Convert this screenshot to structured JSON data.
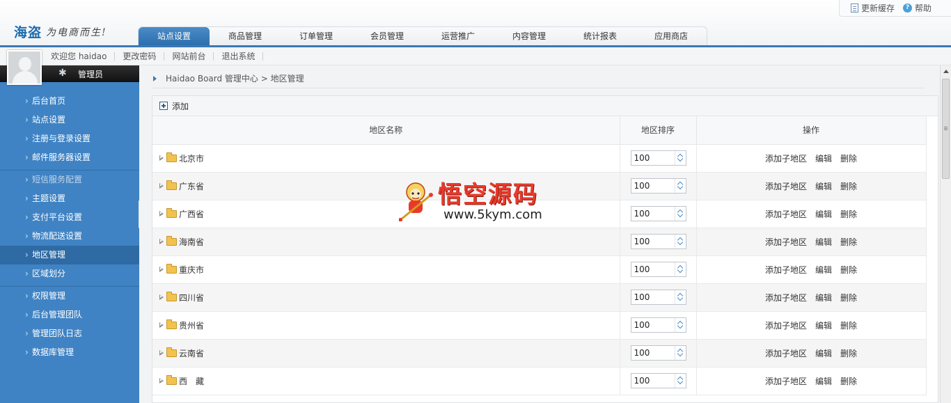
{
  "brand": {
    "logo": "海盗",
    "slogan": "为电商而生!"
  },
  "toplinks": {
    "refresh_cache": "更新缓存",
    "help": "帮助"
  },
  "tabs": [
    "站点设置",
    "商品管理",
    "订单管理",
    "会员管理",
    "运营推广",
    "内容管理",
    "统计报表",
    "应用商店"
  ],
  "userbar": {
    "welcome": "欢迎您 haidao",
    "change_password": "更改密码",
    "site_front": "网站前台",
    "logout": "退出系统"
  },
  "admin": {
    "role": "管理员"
  },
  "sidebar": {
    "group1": [
      "后台首页",
      "站点设置",
      "注册与登录设置",
      "邮件服务器设置"
    ],
    "group2": [
      "短信服务配置",
      "主题设置",
      "支付平台设置",
      "物流配送设置",
      "地区管理",
      "区域划分"
    ],
    "group3": [
      "权限管理",
      "后台管理团队",
      "管理团队日志",
      "数据库管理"
    ],
    "active": "地区管理"
  },
  "breadcrumb": "Haidao Board 管理中心 > 地区管理",
  "toolbar": {
    "add": "添加"
  },
  "table": {
    "headers": [
      "地区名称",
      "地区排序",
      "操作"
    ],
    "actions": {
      "add_child": "添加子地区",
      "edit": "编辑",
      "delete": "删除"
    },
    "rows": [
      {
        "name": "北京市",
        "sort": "100"
      },
      {
        "name": "广东省",
        "sort": "100"
      },
      {
        "name": "广西省",
        "sort": "100"
      },
      {
        "name": "海南省",
        "sort": "100"
      },
      {
        "name": "重庆市",
        "sort": "100"
      },
      {
        "name": "四川省",
        "sort": "100"
      },
      {
        "name": "贵州省",
        "sort": "100"
      },
      {
        "name": "云南省",
        "sort": "100"
      },
      {
        "name": "西　藏",
        "sort": "100"
      }
    ]
  },
  "watermark": {
    "title": "悟空源码",
    "url": "www.5kym.com"
  },
  "colors": {
    "accent": "#3b78b4",
    "sidebar": "#3f83c4",
    "sidebar_active": "#2e6aa3",
    "watermark": "#e83a2a"
  }
}
